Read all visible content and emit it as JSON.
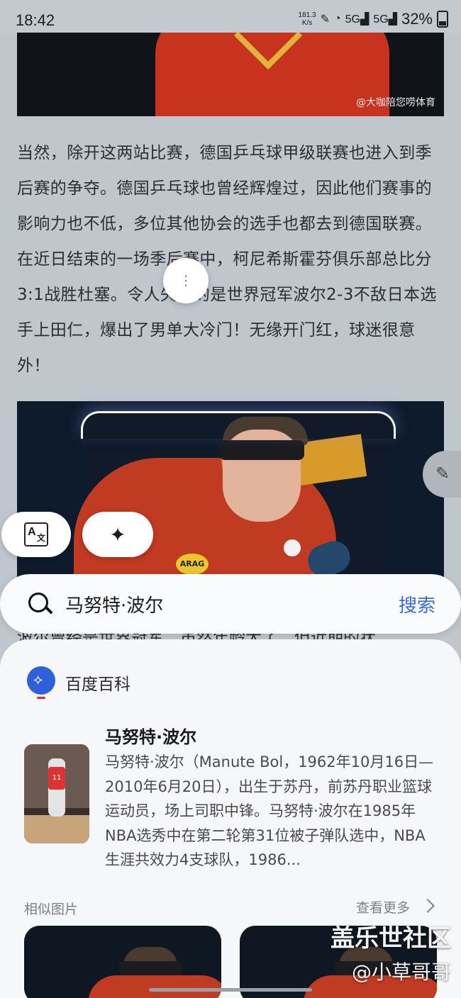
{
  "status_bar": {
    "time": "18:42",
    "net_speed": "181.3",
    "net_unit": "K/s",
    "signal1": "5G",
    "signal2": "5G",
    "battery": "32%"
  },
  "article": {
    "image_caption": "@大咖陪您唠体育",
    "paragraph": "当然，除开这两站比赛，德国乒乓球甲级联赛也进入到季后赛的争夺。德国乒乓球也曾经辉煌过，因此他们赛事的影响力也不低，多位其他协会的选手也都去到德国联赛。在近日结束的一场季后赛中，柯尼希斯霍芬俱乐部总比分3:1战胜杜塞。令人失望的是世界冠军波尔2-3不敌日本选手上田仁，爆出了男单大冷门！无缘开门红，球迷很意外！",
    "image2_logo": "ARAG",
    "hidden_line": "波尔曾经是世界冠军，虽然年龄大了，但近期的状"
  },
  "lens_actions": {
    "translate_icon": "translate-icon",
    "ai_icon": "sparkle-icon",
    "more_icon": "more-vertical-icon",
    "edit_icon": "pencil-icon"
  },
  "search": {
    "query": "马努特·波尔",
    "button": "搜索"
  },
  "result": {
    "source": "百度百科",
    "title": "马努特·波尔",
    "description": "马努特·波尔（Manute Bol，1962年10月16日—2010年6月20日），出生于苏丹，前苏丹职业篮球运动员，场上司职中锋。马努特·波尔在1985年NBA选秀中在第二轮第31位被子弹队选中，NBA生涯共效力4支球队，1986...",
    "jersey_number": "11"
  },
  "similar": {
    "label": "相似图片",
    "more": "查看更多"
  },
  "watermark": {
    "line1": "盖乐世社区",
    "line2": "@小草哥哥"
  },
  "colors": {
    "accent": "#3a6bd6",
    "background": "#bfc6cc"
  }
}
